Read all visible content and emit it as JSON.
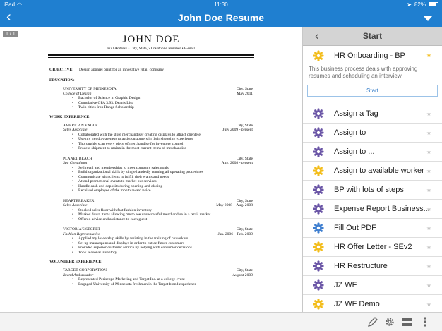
{
  "status": {
    "carrier": "iPad",
    "time": "11:30",
    "battery": "82%"
  },
  "nav": {
    "title": "John Doe Resume",
    "back_icon": "chevron-left-icon",
    "menu_icon": "caret-down-icon"
  },
  "document": {
    "page_badge": "1 / 1",
    "name": "JOHN DOE",
    "address": "Full Address • City, State, ZIP • Phone Number • E-mail",
    "objective_label": "OBJECTIVE:",
    "objective": "Design apparel print for an innovative retail company",
    "education_heading": "EDUCATION:",
    "education": {
      "school": "UNIVERSITY OF MINNESOTA",
      "location": "City, State",
      "college": "College of Design",
      "date": "May 2011",
      "bullets": [
        "Bachelor of Science in Graphic Design",
        "Cumulative GPA 3.93, Dean's List",
        "Twin cities Iron Range Scholarship"
      ]
    },
    "work_heading": "WORK EXPERIENCE:",
    "jobs": [
      {
        "company": "AMERICAN EAGLE",
        "location": "City, State",
        "title": "Sales Associate",
        "date": "July 2009 - present",
        "bullets": [
          "Collaborated with the store merchandiser creating displays to attract clientele",
          "Use my trend awareness to assist customers in their shopping experience",
          "Thoroughly scan every piece of merchandise for inventory control",
          "Process shipment to maintain the most current items of merchandise"
        ]
      },
      {
        "company": "PLANET BEACH",
        "location": "City, State",
        "title": "Spa Consultant",
        "date": "Aug. 2008 - present",
        "bullets": [
          "Sell retail and memberships to meet company sales goals",
          "Build organizational skills by single handedly running all operating procedures",
          "Communicate with clients to fulfill their wants and needs",
          "Attend promotional events to market our services",
          "Handle cash and deposits during opening and closing",
          "Received employee of the month award twice"
        ]
      },
      {
        "company": "HEARTBREAKER",
        "location": "City, State",
        "title": "Sales Associate",
        "date": "May 2008 – Aug. 2008",
        "bullets": [
          "Stocked sales floor with fast fashion inventory",
          "Marked down items allowing me to see unsuccessful merchandise in a retail market",
          "Offered advice and assistance to each guest"
        ]
      },
      {
        "company": "VICTORIA'S SECRET",
        "location": "City, State",
        "title": "Fashion Representative",
        "date": "Jan. 2006 – Feb. 2009",
        "bullets": [
          "Applied my leadership skills by assisting in the training of coworkers",
          "Set up mannequins and displays in order to entice future customers",
          "Provided superior customer service by helping with consumer decisions",
          "Took seasonal inventory"
        ]
      }
    ],
    "volunteer_heading": "VOLUNTEER EXPERIENCE:",
    "volunteer": {
      "company": "TARGET CORPORATION",
      "location": "City, State",
      "title": "Brand Ambassador",
      "date": "August 2009",
      "bullets": [
        "Represented Periscope Marketing and Target Inc. at a college event",
        "Engaged University of Minnesota freshman in the Target brand experience"
      ]
    }
  },
  "panel": {
    "title": "Start",
    "featured": {
      "label": "HR Onboarding - BP",
      "description": "This business process deals with approving resumes and scheduling an interview.",
      "start_label": "Start",
      "color": "#f3bd1b"
    },
    "items": [
      {
        "label": "Assign a Tag",
        "color": "#6a55a6"
      },
      {
        "label": "Assign to",
        "color": "#6a55a6"
      },
      {
        "label": "Assign to ...",
        "color": "#6a55a6"
      },
      {
        "label": "Assign to available worker",
        "color": "#f3bd1b"
      },
      {
        "label": "BP with lots of steps",
        "color": "#6a55a6"
      },
      {
        "label": "Expense Report Business...",
        "color": "#6a55a6"
      },
      {
        "label": "Fill Out PDF",
        "color": "#3f7fd0"
      },
      {
        "label": "HR Offer Letter - SEv2",
        "color": "#f3bd1b"
      },
      {
        "label": "HR Restructure",
        "color": "#6a55a6"
      },
      {
        "label": "JZ WF",
        "color": "#6a55a6"
      },
      {
        "label": "JZ WF Demo",
        "color": "#f3bd1b"
      }
    ]
  },
  "toolbar": {
    "icons": [
      "pencil-icon",
      "gear-icon",
      "layout-icon",
      "more-vertical-icon"
    ]
  }
}
